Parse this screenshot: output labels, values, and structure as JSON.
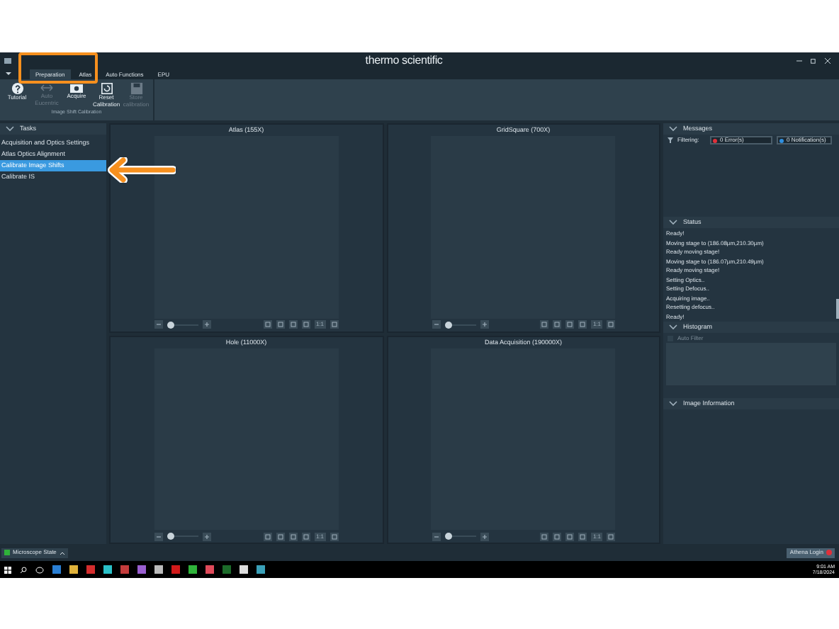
{
  "window": {
    "brand": "thermo scientific"
  },
  "tabs": [
    {
      "label": "Preparation",
      "selected": true
    },
    {
      "label": "Atlas",
      "selected": false
    },
    {
      "label": "Auto Functions",
      "selected": false
    },
    {
      "label": "EPU",
      "selected": false
    }
  ],
  "ribbon": {
    "buttons": [
      {
        "label": "Tutorial",
        "disabled": false
      },
      {
        "label": "Auto Eucentric",
        "disabled": true
      },
      {
        "label": "Acquire",
        "disabled": false
      },
      {
        "label": "Reset Calibration",
        "disabled": false
      },
      {
        "label": "Store calibration",
        "disabled": true
      }
    ],
    "group_label": "Image Shift Calibration"
  },
  "tasks": {
    "title": "Tasks",
    "items": [
      {
        "label": "Acquisition and Optics Settings",
        "selected": false
      },
      {
        "label": "Atlas Optics Alignment",
        "selected": false
      },
      {
        "label": "Calibrate Image Shifts",
        "selected": true
      },
      {
        "label": "Calibrate IS",
        "selected": false
      }
    ]
  },
  "views": [
    {
      "title": "Atlas (155X)",
      "level": 0.12,
      "ratio_label": "1:1"
    },
    {
      "title": "GridSquare (700X)",
      "level": 0.12,
      "ratio_label": "1:1"
    },
    {
      "title": "Hole (11000X)",
      "level": 0.12,
      "ratio_label": "1:1"
    },
    {
      "title": "Data Acquisition (190000X)",
      "level": 0.12,
      "ratio_label": "1:1"
    }
  ],
  "messages": {
    "title": "Messages",
    "filter_label": "Filtering:",
    "errors": "0 Error(s)",
    "notifications": "0 Notification(s)"
  },
  "status": {
    "title": "Status",
    "lines": [
      "Ready!",
      "Moving stage to (186.08µm,210.30µm)",
      "Ready moving stage!",
      "Moving stage to (186.07µm,210.49µm)",
      "Ready moving stage!",
      "Setting Optics..",
      "Setting Defocus..",
      "Acquiring image..",
      "Resetting defocus..",
      "Ready!"
    ]
  },
  "histogram": {
    "title": "Histogram",
    "auto_filter": {
      "label": "Auto Filter",
      "checked": false
    }
  },
  "image_information": {
    "title": "Image Information"
  },
  "status_bar": {
    "microscope_state": "Microscope State",
    "login": "Athena Login"
  },
  "taskbar": {
    "time": "9:01 AM",
    "date": "7/18/2024"
  },
  "annotations": {
    "highlight": true,
    "arrow": true
  }
}
